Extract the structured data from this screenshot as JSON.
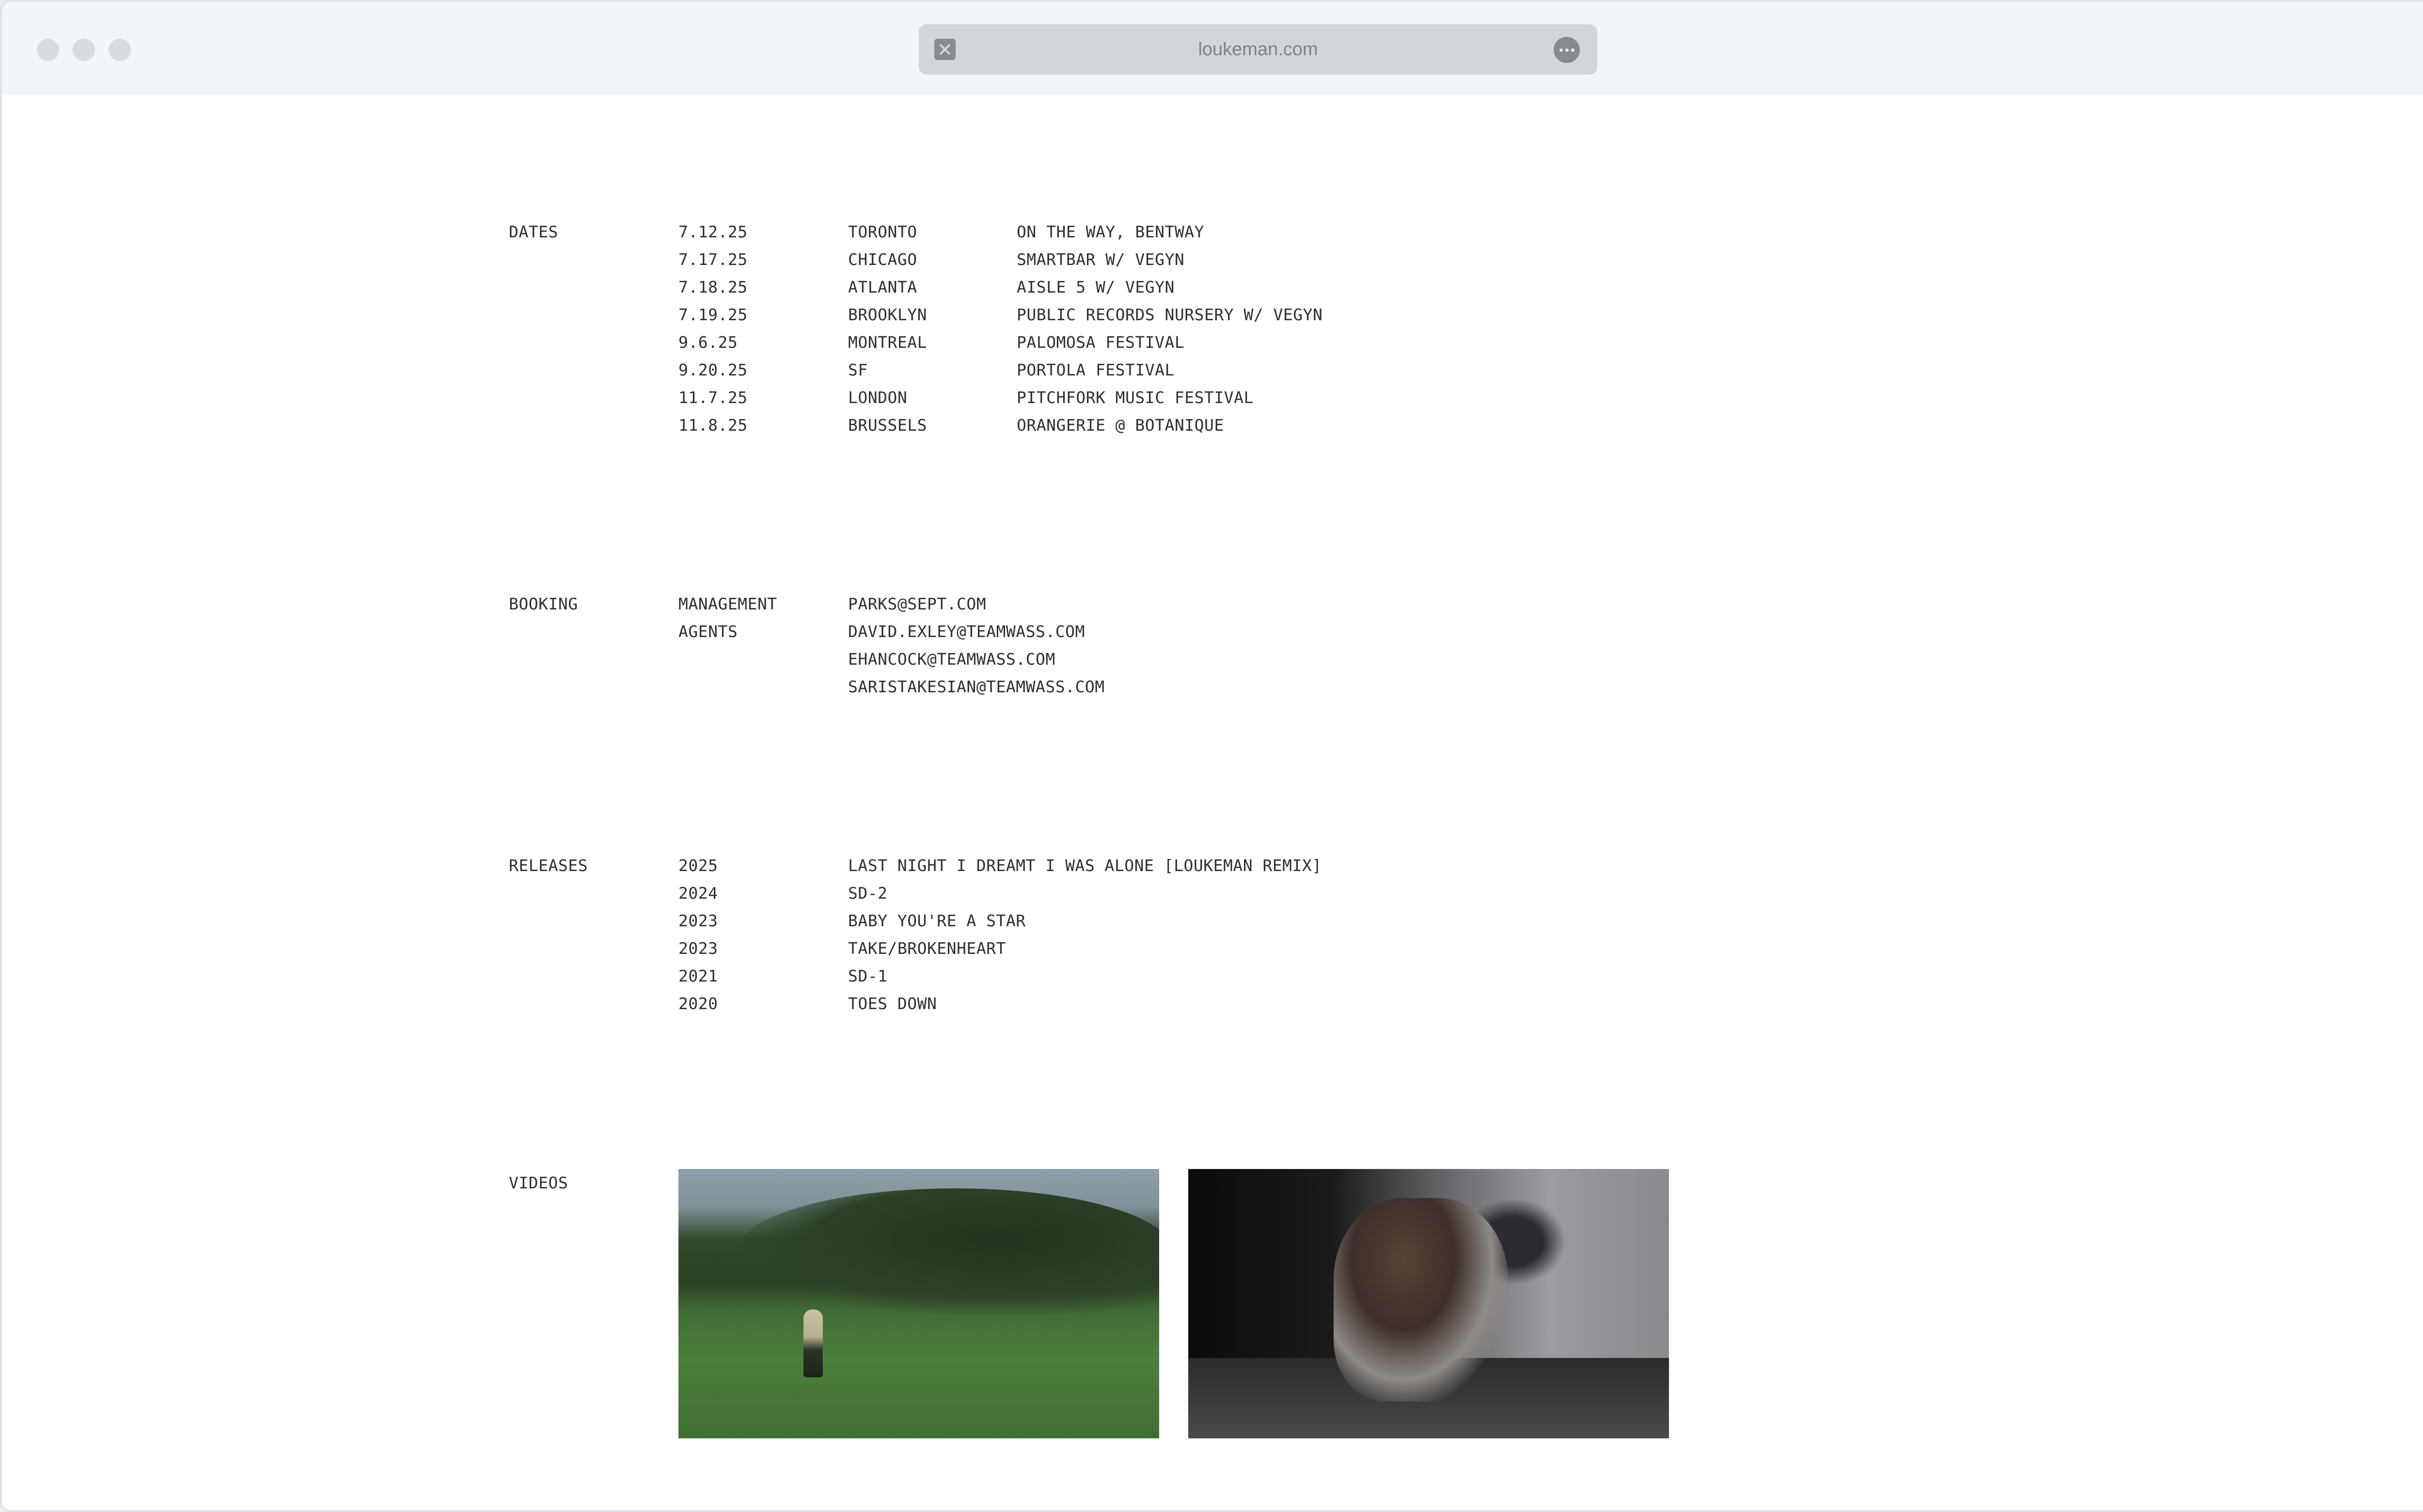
{
  "browser": {
    "url": "loukeman.com",
    "stop_icon": "close-icon",
    "more_icon": "ellipsis-icon"
  },
  "dates": {
    "label": "DATES",
    "rows": [
      {
        "date": "7.12.25",
        "city": "TORONTO",
        "venue": "ON THE WAY, BENTWAY"
      },
      {
        "date": "7.17.25",
        "city": "CHICAGO",
        "venue": "SMARTBAR W/ VEGYN"
      },
      {
        "date": "7.18.25",
        "city": "ATLANTA",
        "venue": "AISLE 5 W/ VEGYN"
      },
      {
        "date": "7.19.25",
        "city": "BROOKLYN",
        "venue": "PUBLIC RECORDS NURSERY W/ VEGYN"
      },
      {
        "date": "9.6.25",
        "city": "MONTREAL",
        "venue": "PALOMOSA FESTIVAL"
      },
      {
        "date": "9.20.25",
        "city": "SF",
        "venue": "PORTOLA FESTIVAL"
      },
      {
        "date": "11.7.25",
        "city": "LONDON",
        "venue": "PITCHFORK MUSIC FESTIVAL"
      },
      {
        "date": "11.8.25",
        "city": "BRUSSELS",
        "venue": "ORANGERIE @ BOTANIQUE"
      }
    ]
  },
  "booking": {
    "label": "BOOKING",
    "rows": [
      {
        "role": "MANAGEMENT",
        "email": "PARKS@SEPT.COM"
      },
      {
        "role": "AGENTS",
        "email": "DAVID.EXLEY@TEAMWASS.COM"
      },
      {
        "role": "",
        "email": "EHANCOCK@TEAMWASS.COM"
      },
      {
        "role": "",
        "email": "SARISTAKESIAN@TEAMWASS.COM"
      }
    ]
  },
  "releases": {
    "label": "RELEASES",
    "rows": [
      {
        "year": "2025",
        "title": "LAST NIGHT I DREAMT I WAS ALONE [LOUKEMAN REMIX]"
      },
      {
        "year": "2024",
        "title": "SD-2"
      },
      {
        "year": "2023",
        "title": "BABY YOU'RE A STAR"
      },
      {
        "year": "2023",
        "title": "TAKE/BROKENHEART"
      },
      {
        "year": "2021",
        "title": "SD-1"
      },
      {
        "year": "2020",
        "title": "TOES DOWN"
      }
    ]
  },
  "videos": {
    "label": "VIDEOS"
  }
}
